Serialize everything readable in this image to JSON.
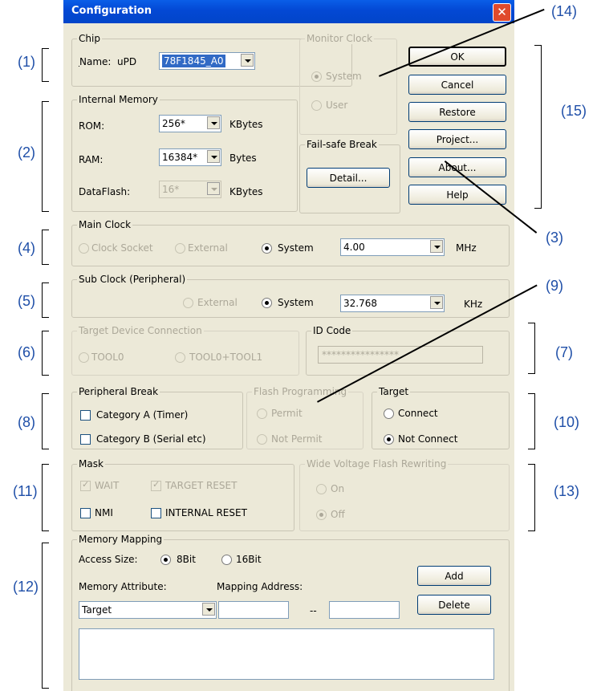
{
  "dialog": {
    "title": "Configuration",
    "close_symbol": "✕"
  },
  "chip": {
    "legend": "Chip",
    "name_label": "Name:",
    "prefix": "uPD",
    "name_value": "78F1845_A0"
  },
  "monitor_clock": {
    "legend": "Monitor Clock",
    "system": "System",
    "user": "User"
  },
  "buttons": {
    "ok": "OK",
    "cancel": "Cancel",
    "restore": "Restore",
    "project": "Project...",
    "about": "About...",
    "help": "Help"
  },
  "internal_memory": {
    "legend": "Internal Memory",
    "rom_label": "ROM:",
    "rom_value": "256*",
    "rom_unit": "KBytes",
    "ram_label": "RAM:",
    "ram_value": "16384*",
    "ram_unit": "Bytes",
    "dataflash_label": "DataFlash:",
    "dataflash_value": "16*",
    "dataflash_unit": "KBytes"
  },
  "fail_safe": {
    "legend": "Fail-safe Break",
    "detail_button": "Detail..."
  },
  "main_clock": {
    "legend": "Main Clock",
    "clock_socket": "Clock Socket",
    "external": "External",
    "system": "System",
    "value": "4.00",
    "unit": "MHz"
  },
  "sub_clock": {
    "legend": "Sub Clock (Peripheral)",
    "external": "External",
    "system": "System",
    "value": "32.768",
    "unit": "KHz"
  },
  "target_connection": {
    "legend": "Target Device Connection",
    "tool0": "TOOL0",
    "tool0_tool1": "TOOL0+TOOL1"
  },
  "id_code": {
    "legend": "ID Code",
    "value": "****************"
  },
  "peripheral_break": {
    "legend": "Peripheral Break",
    "cat_a": "Category A (Timer)",
    "cat_b": "Category B (Serial etc)"
  },
  "flash_programming": {
    "legend": "Flash Programming",
    "permit": "Permit",
    "not_permit": "Not Permit"
  },
  "target": {
    "legend": "Target",
    "connect": "Connect",
    "not_connect": "Not Connect"
  },
  "mask": {
    "legend": "Mask",
    "wait": "WAIT",
    "target_reset": "TARGET RESET",
    "nmi": "NMI",
    "internal_reset": "INTERNAL RESET"
  },
  "wide_voltage": {
    "legend": "Wide Voltage Flash Rewriting",
    "on": "On",
    "off": "Off"
  },
  "memory_mapping": {
    "legend": "Memory Mapping",
    "access_size_label": "Access Size:",
    "bit8": "8Bit",
    "bit16": "16Bit",
    "attribute_label": "Memory Attribute:",
    "mapping_label": "Mapping Address:",
    "attribute_value": "Target",
    "separator": "--",
    "add_button": "Add",
    "delete_button": "Delete"
  },
  "callouts": {
    "c1": "(1)",
    "c2": "(2)",
    "c3": "(3)",
    "c4": "(4)",
    "c5": "(5)",
    "c6": "(6)",
    "c7": "(7)",
    "c8": "(8)",
    "c9": "(9)",
    "c10": "(10)",
    "c11": "(11)",
    "c12": "(12)",
    "c13": "(13)",
    "c14": "(14)",
    "c15": "(15)"
  },
  "colors": {
    "callout": "#1f4fa8",
    "titlebar": "#0348d4",
    "dialog_bg": "#ece9d8",
    "selection": "#316ac5"
  }
}
